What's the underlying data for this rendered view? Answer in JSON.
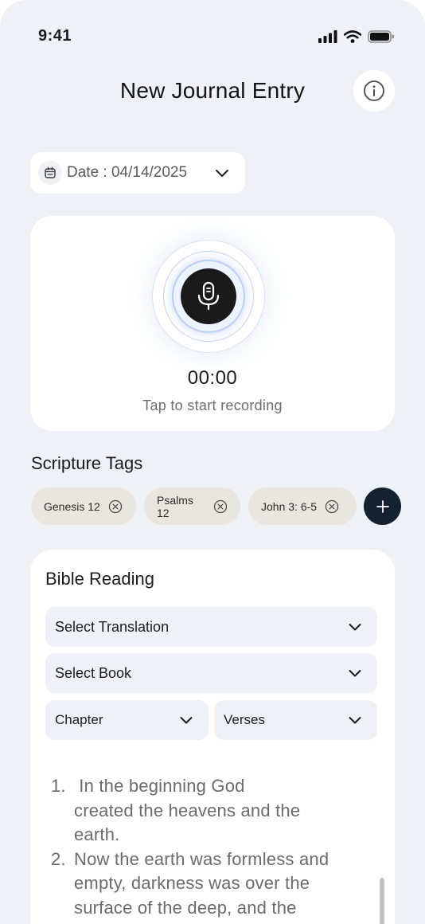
{
  "status_bar": {
    "time": "9:41",
    "icons": [
      "cellular-signal-icon",
      "wifi-icon",
      "battery-icon"
    ]
  },
  "header": {
    "title": "New Journal Entry",
    "info_icon": "info-icon"
  },
  "date_picker": {
    "label": "Date : 04/14/2025",
    "icon": "calendar-icon"
  },
  "recorder": {
    "timer": "00:00",
    "hint": "Tap to start recording",
    "icon": "microphone-icon"
  },
  "scripture_tags": {
    "title": "Scripture Tags",
    "tags": [
      {
        "label": "Genesis 12"
      },
      {
        "label": "Psalms 12"
      },
      {
        "label": "John 3: 6-5"
      }
    ]
  },
  "bible_reading": {
    "title": "Bible Reading",
    "translation_placeholder": "Select Translation",
    "book_placeholder": "Select Book",
    "chapter_placeholder": "Chapter",
    "verses_placeholder": "Verses",
    "passage": [
      {
        "num": "1.",
        "lines": [
          " In the beginning God",
          "created the heavens and the",
          "earth."
        ]
      },
      {
        "num": "2.",
        "lines": [
          "Now the earth was formless and",
          "empty, darkness was over the",
          "surface of the deep, and the"
        ]
      }
    ]
  },
  "colors": {
    "background": "#eef2f6",
    "card": "#ffffff",
    "tag": "#e9e6df",
    "accent_dark": "#142131",
    "mic_button": "#1a1a1a"
  }
}
